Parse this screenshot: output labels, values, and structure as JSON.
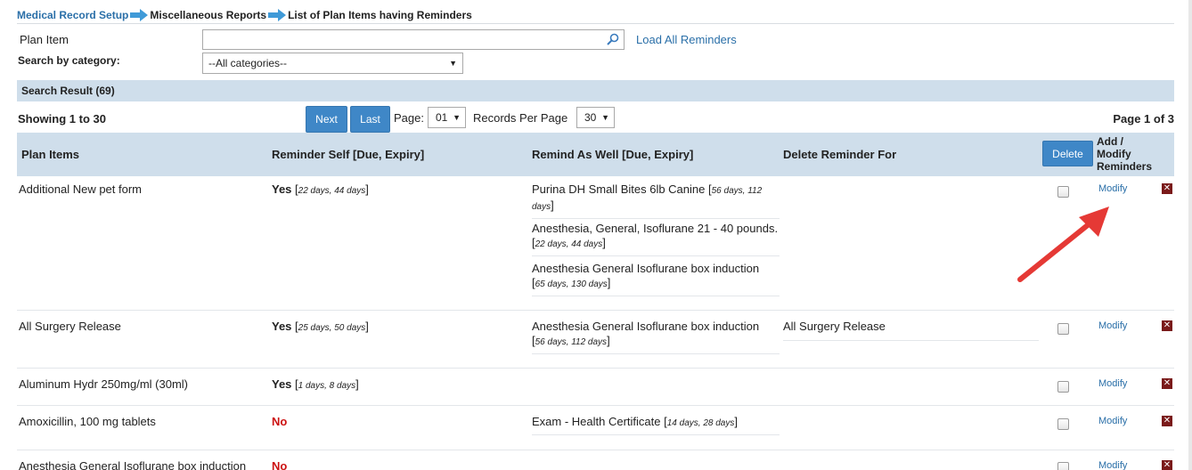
{
  "breadcrumb": {
    "level1": "Medical Record Setup",
    "level2": "Miscellaneous Reports",
    "level3": "List of Plan Items having Reminders"
  },
  "search": {
    "plan_item_label": "Plan Item",
    "plan_item_value": "",
    "load_all_label": "Load All Reminders",
    "category_label": "Search by category:",
    "category_selected": "--All categories--"
  },
  "result_bar": "Search Result (69)",
  "pagination": {
    "showing": "Showing 1 to 30",
    "next_label": "Next",
    "last_label": "Last",
    "page_label": "Page:",
    "page_value": "01",
    "records_label": "Records Per Page",
    "records_value": "30",
    "page_of": "Page 1 of 3"
  },
  "table": {
    "headers": {
      "plan_items": "Plan Items",
      "reminder_self": "Reminder Self [Due, Expiry]",
      "remind_as_well": "Remind As Well [Due, Expiry]",
      "delete_for": "Delete Reminder For",
      "delete_button": "Delete",
      "add_modify_1": "Add /",
      "add_modify_2": "Modify",
      "add_modify_3": "Reminders"
    },
    "rows": [
      {
        "plan_item": "Additional New pet form",
        "self_flag": "Yes",
        "self_detail": "22 days, 44 days",
        "remind": [
          {
            "name": "Purina DH Small Bites 6lb Canine",
            "detail": "56 days, 112 days"
          },
          {
            "name": "Anesthesia, General, Isoflurane 21 - 40 pounds.",
            "detail": "22 days, 44 days"
          },
          {
            "name": "Anesthesia General Isoflurane box induction",
            "detail": "65 days, 130 days"
          }
        ],
        "delete_for": "",
        "modify": "Modify"
      },
      {
        "plan_item": "All Surgery Release",
        "self_flag": "Yes",
        "self_detail": "25 days, 50 days",
        "remind": [
          {
            "name": "Anesthesia General Isoflurane box induction",
            "detail": "56 days, 112 days"
          }
        ],
        "delete_for": "All Surgery Release",
        "modify": "Modify"
      },
      {
        "plan_item": "Aluminum Hydr 250mg/ml (30ml)",
        "self_flag": "Yes",
        "self_detail": "1 days, 8 days",
        "remind": [],
        "delete_for": "",
        "modify": "Modify"
      },
      {
        "plan_item": "Amoxicillin, 100 mg tablets",
        "self_flag": "No",
        "self_detail": "",
        "remind": [
          {
            "name": "Exam - Health Certificate",
            "detail": "14 days, 28 days"
          }
        ],
        "delete_for": "",
        "modify": "Modify"
      },
      {
        "plan_item": "Anesthesia General Isoflurane box induction",
        "self_flag": "No",
        "self_detail": "",
        "remind": [],
        "delete_for": "",
        "modify": "Modify"
      }
    ]
  },
  "icons": {
    "breadcrumb_arrow": "arrow-right-icon",
    "search": "magnifier-icon",
    "delete_row": "x-box-icon"
  },
  "colors": {
    "header_bg": "#cfdeeb",
    "link": "#2a6fa8",
    "button": "#3f87c7",
    "no_text": "#cc1111",
    "delete_x": "#7a1a1a",
    "annotation_arrow": "#e53935"
  }
}
